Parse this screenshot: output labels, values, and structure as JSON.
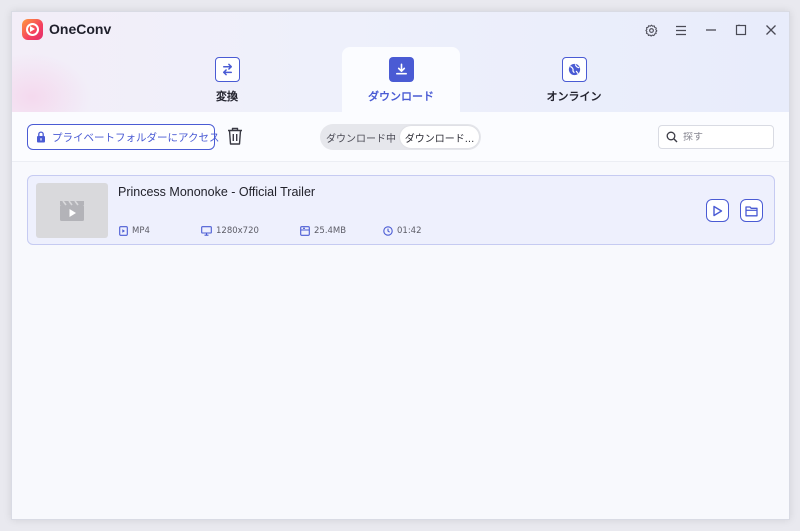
{
  "app": {
    "title": "OneConv"
  },
  "window_controls": {
    "settings_icon": "gear-icon",
    "menu_icon": "menu-icon",
    "minimize_icon": "minimize-icon",
    "maximize_icon": "maximize-icon",
    "close_icon": "close-icon"
  },
  "tabs": [
    {
      "label": "変換",
      "icon": "convert-icon",
      "active": false
    },
    {
      "label": "ダウンロード",
      "icon": "download-icon",
      "active": true
    },
    {
      "label": "オンライン",
      "icon": "online-icon",
      "active": false
    }
  ],
  "toolbar": {
    "private_folder_label": "プライベートフォルダーにアクセス",
    "segment": {
      "downloading": "ダウンロード中",
      "downloaded": "ダウンロード..."
    },
    "search_placeholder": "探す"
  },
  "items": [
    {
      "title": "Princess Mononoke - Official Trailer",
      "format": "MP4",
      "resolution": "1280x720",
      "size": "25.4MB",
      "duration": "01:42"
    }
  ],
  "colors": {
    "accent": "#4a5bd4",
    "card_bg": "#eef0fd",
    "card_border": "#c6cbf2"
  }
}
